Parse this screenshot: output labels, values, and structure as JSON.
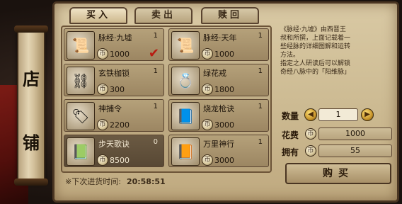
{
  "tabs": [
    {
      "label": "买入"
    },
    {
      "label": "卖出"
    },
    {
      "label": "赎回"
    }
  ],
  "sign": {
    "char1": "店",
    "char2": "铺"
  },
  "items": [
    {
      "name": "脉经·九墟",
      "count": "1",
      "price": "1000",
      "icon": "scroll-icon",
      "glyph": "📜",
      "selected": true,
      "dark": false
    },
    {
      "name": "脉经·天年",
      "count": "1",
      "price": "1000",
      "icon": "scroll-icon",
      "glyph": "📜",
      "selected": false,
      "dark": false
    },
    {
      "name": "玄铁枷锁",
      "count": "1",
      "price": "300",
      "icon": "shackle-icon",
      "glyph": "⛓",
      "selected": false,
      "dark": false
    },
    {
      "name": "绿花戒",
      "count": "1",
      "price": "1800",
      "icon": "ring-icon",
      "glyph": "💍",
      "selected": false,
      "dark": false
    },
    {
      "name": "神捕令",
      "count": "1",
      "price": "2200",
      "icon": "token-icon",
      "glyph": "🏷",
      "selected": false,
      "dark": false
    },
    {
      "name": "烧龙枪诀",
      "count": "1",
      "price": "3000",
      "icon": "book-icon",
      "glyph": "📘",
      "selected": false,
      "dark": false
    },
    {
      "name": "步天歌诀",
      "count": "0",
      "price": "8500",
      "icon": "book-icon",
      "glyph": "📗",
      "selected": false,
      "dark": true
    },
    {
      "name": "万里神行",
      "count": "1",
      "price": "3000",
      "icon": "book-icon",
      "glyph": "📙",
      "selected": false,
      "dark": false
    }
  ],
  "restock": {
    "label": "※下次进货时间:",
    "time": "20:58:51"
  },
  "description": {
    "lines": [
      "《脉经·九墟》由西晋王",
      "叔和所撰，上面记载着一",
      "些经脉的详细图解和运转",
      "方法。",
      "指定之人研读后可以解锁",
      "奇经八脉中的「阳维脉」"
    ]
  },
  "purchase": {
    "qty_label": "数量",
    "qty_value": "1",
    "cost_label": "花费",
    "cost_value": "1000",
    "owned_label": "拥有",
    "owned_value": "55",
    "buy_label": "购买",
    "coin_glyph": "币"
  }
}
